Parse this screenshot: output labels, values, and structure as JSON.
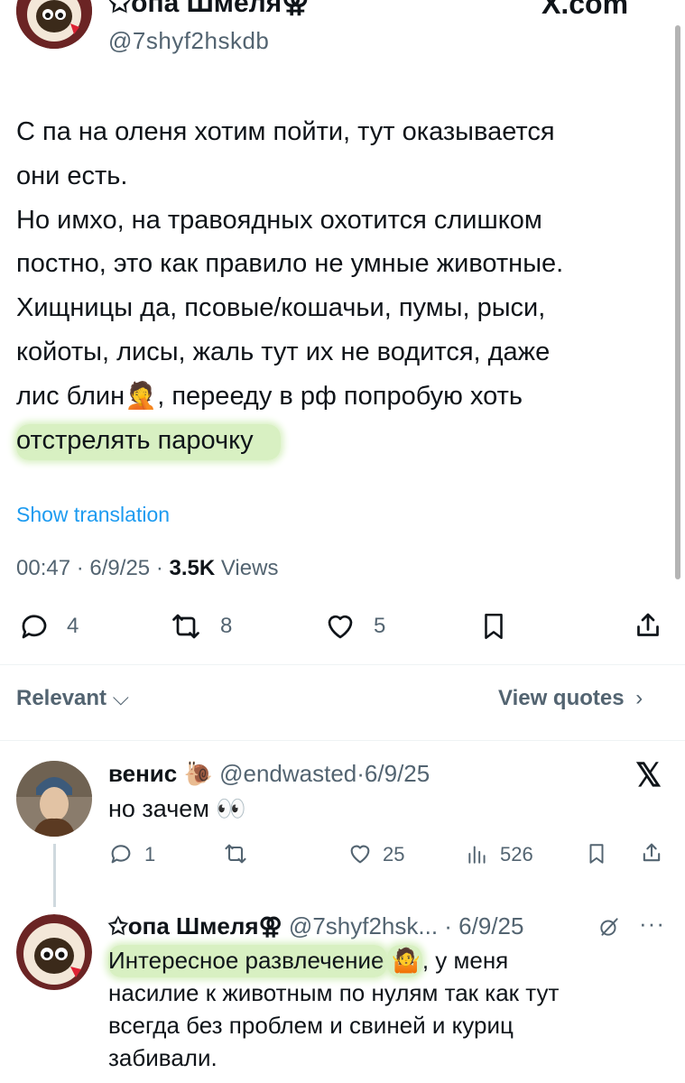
{
  "main_tweet": {
    "author_name": "✩опа Шмеля⚢",
    "author_handle": "@7shyf2hskdb",
    "site": "X.com",
    "text_lines": [
      "С па на оленя хотим пойти, тут оказывается",
      "они есть.",
      "Но имхо, на травоядных охотится слишком",
      "постно, это как правило не умные животные.",
      "Хищницы да, псовые/кошачьи, пумы, рыси,",
      "койоты, лисы, жаль тут их не водится, даже"
    ],
    "text_line7_a": "лис блин",
    "text_line7_emoji": "🤦",
    "text_line7_b": ", перееду в рф попробую хоть",
    "text_line8_highlighted": "отстрелять парочку",
    "show_translation": "Show translation",
    "time": "00:47",
    "date": "6/9/25",
    "views_count": "3.5K",
    "views_label": "Views",
    "replies": "4",
    "reposts": "8",
    "likes": "5"
  },
  "filter": {
    "sort_label": "Relevant",
    "view_quotes": "View quotes"
  },
  "reply1": {
    "name": "венис",
    "emoji": "🐌",
    "handle": "@endwasted",
    "date": "6/9/25",
    "text": "но зачем",
    "text_emoji": "👀",
    "replies": "1",
    "reposts": "",
    "likes": "25",
    "views": "526"
  },
  "reply2": {
    "name": "✩опа Шмеля⚢",
    "handle": "@7shyf2hsk...",
    "date": "6/9/25",
    "text_highlighted": "Интересное развлечение",
    "emoji": "🤷",
    "text_rest_line1": ", у меня",
    "text_lines": [
      "насилие к животным по нулям так как тут",
      "всегда без проблем и свиней и куриц",
      "забивали."
    ]
  },
  "colors": {
    "text": "#0f1419",
    "secondary": "#536471",
    "link": "#1d9bf0",
    "highlight": "#d8f0c2"
  }
}
